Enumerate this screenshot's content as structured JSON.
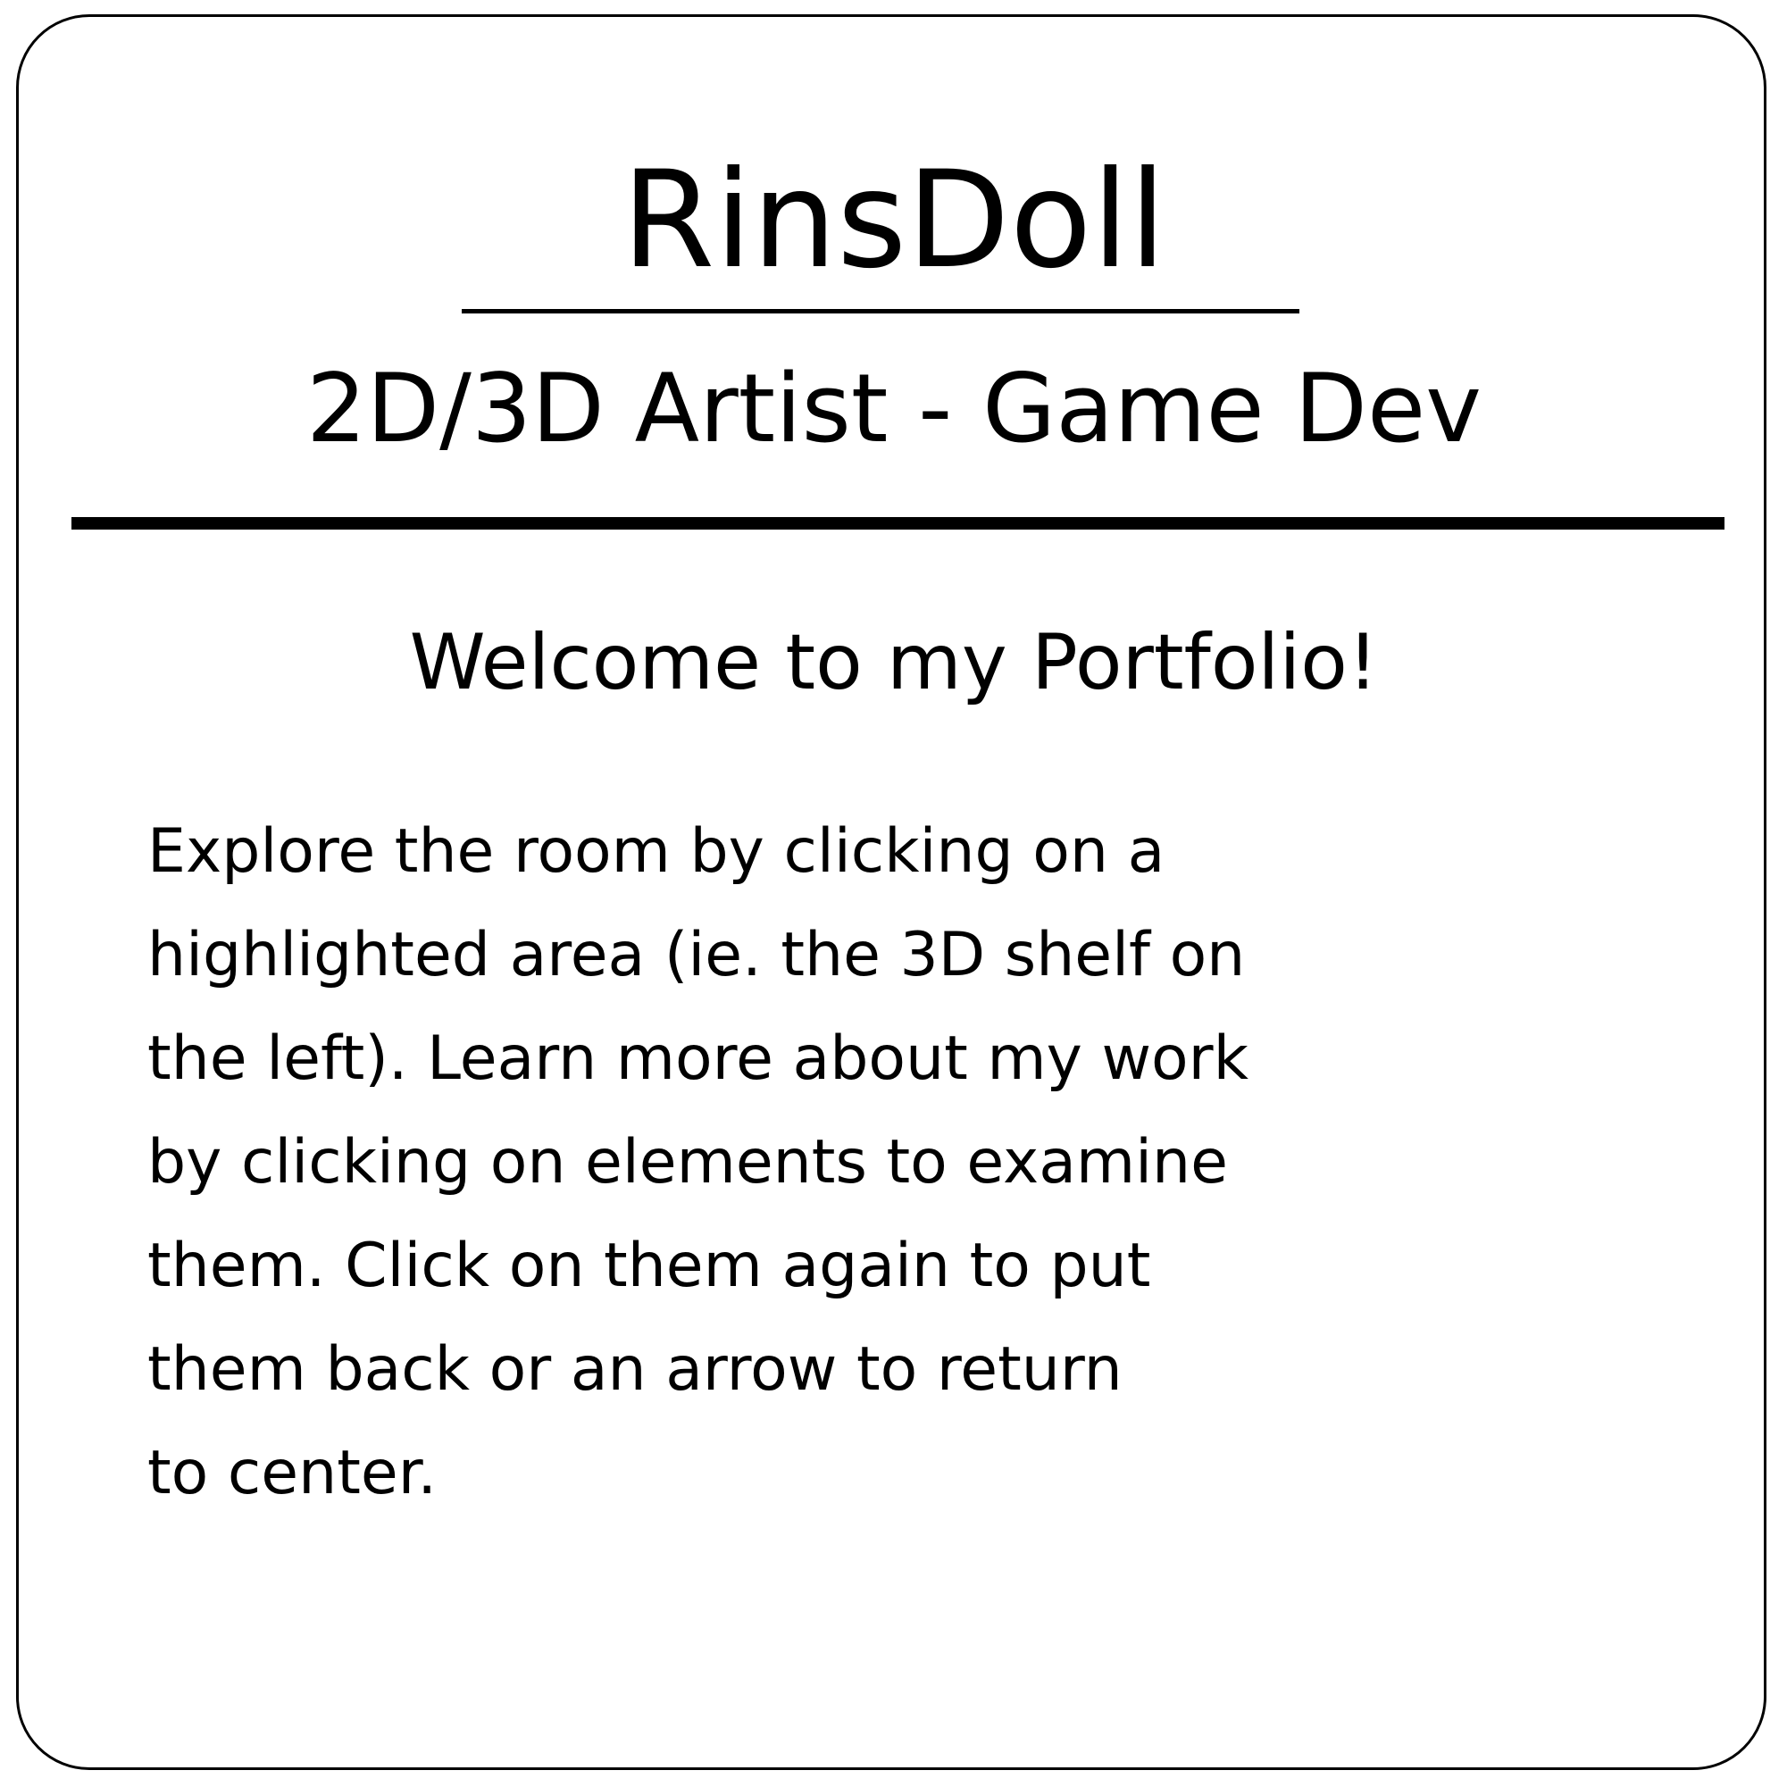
{
  "card": {
    "title": "RinsDoll",
    "subtitle": "2D/3D Artist - Game Dev",
    "heading": "Welcome to my Portfolio!",
    "body_lines": [
      "Explore the room by clicking on a",
      "highlighted area (ie. the 3D shelf on",
      "the left).  Learn more about my work",
      "by clicking on elements to examine",
      "them.  Click on them again to put",
      "them back or an arrow to return",
      "to center."
    ]
  }
}
